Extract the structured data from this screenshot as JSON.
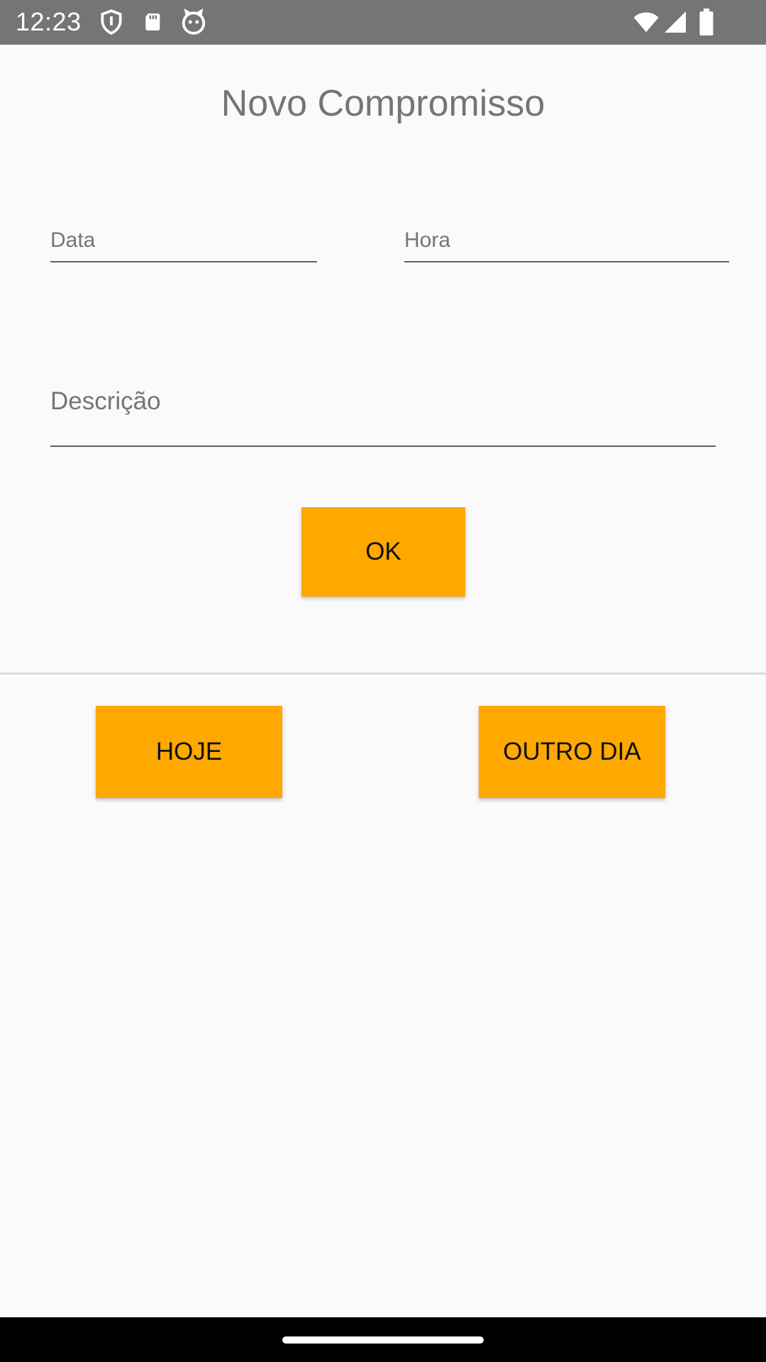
{
  "status_bar": {
    "time": "12:23",
    "icons": [
      "shield-icon",
      "sdcard-icon",
      "cat-icon",
      "wifi-icon",
      "signal-icon",
      "battery-icon"
    ],
    "background": "#757575"
  },
  "page": {
    "title": "Novo Compromisso"
  },
  "form": {
    "data_label": "Data",
    "hora_label": "Hora",
    "descricao_label": "Descrição"
  },
  "buttons": {
    "ok": "OK",
    "hoje": "HOJE",
    "outro_dia": "OUTRO DIA",
    "color": "#ffa800"
  },
  "navigation": {
    "handle": "gesture-handle"
  }
}
